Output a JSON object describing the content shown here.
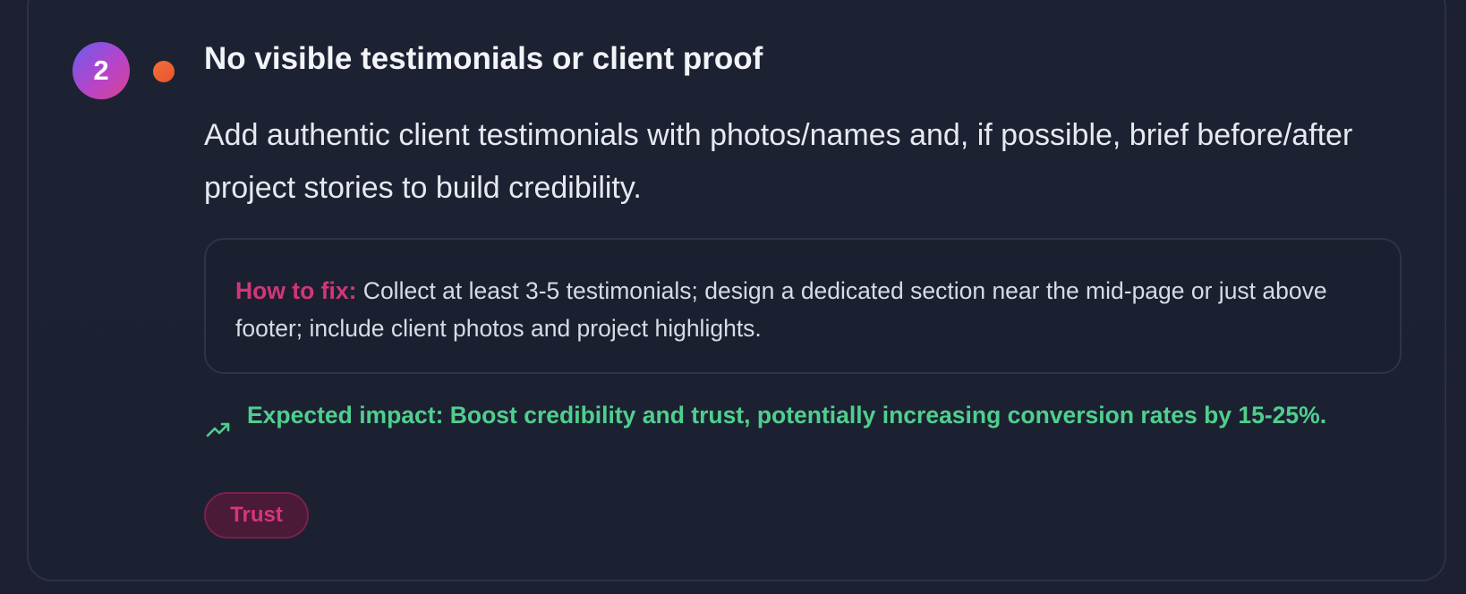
{
  "issue": {
    "rank": "2",
    "severity_color": "#ec5a32",
    "title": "No visible testimonials or client proof",
    "description": "Add authentic client testimonials with photos/names and, if possible, brief before/after project stories to build credibility.",
    "fix": {
      "label": "How to fix:",
      "text": " Collect at least 3-5 testimonials; design a dedicated section near the mid-page or just above footer; include client photos and project highlights."
    },
    "impact": {
      "icon": "trending-up-icon",
      "text": "Expected impact: Boost credibility and trust, potentially increasing conversion rates by 15-25%."
    },
    "tag": "Trust"
  },
  "colors": {
    "background": "#1c2030",
    "accent_pink": "#d3357a",
    "impact_green": "#4fcf8d",
    "badge_gradient_start": "#6b5cf0",
    "badge_gradient_end": "#d9448e"
  }
}
